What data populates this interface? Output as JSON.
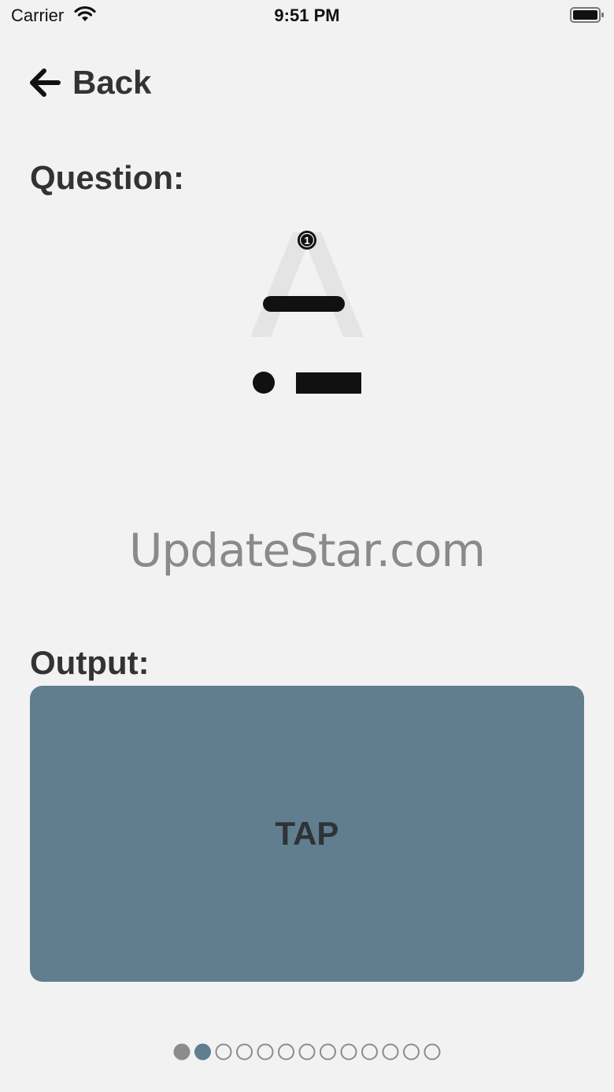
{
  "status_bar": {
    "carrier": "Carrier",
    "time": "9:51 PM"
  },
  "nav": {
    "back_label": "Back"
  },
  "question": {
    "label": "Question:",
    "letter": "A",
    "hint_number": "1",
    "morse": [
      "dot",
      "dash"
    ]
  },
  "watermark": "UpdateStar.com",
  "output": {
    "label": "Output:",
    "tap_label": "TAP"
  },
  "pager": {
    "total": 13,
    "completed": 1,
    "current": 2
  },
  "colors": {
    "background": "#f2f2f2",
    "tap_pad": "#617e8e",
    "dot_done": "#8c8c8c",
    "dot_current": "#617e8e",
    "dot_empty_stroke": "#8c8c8c"
  }
}
